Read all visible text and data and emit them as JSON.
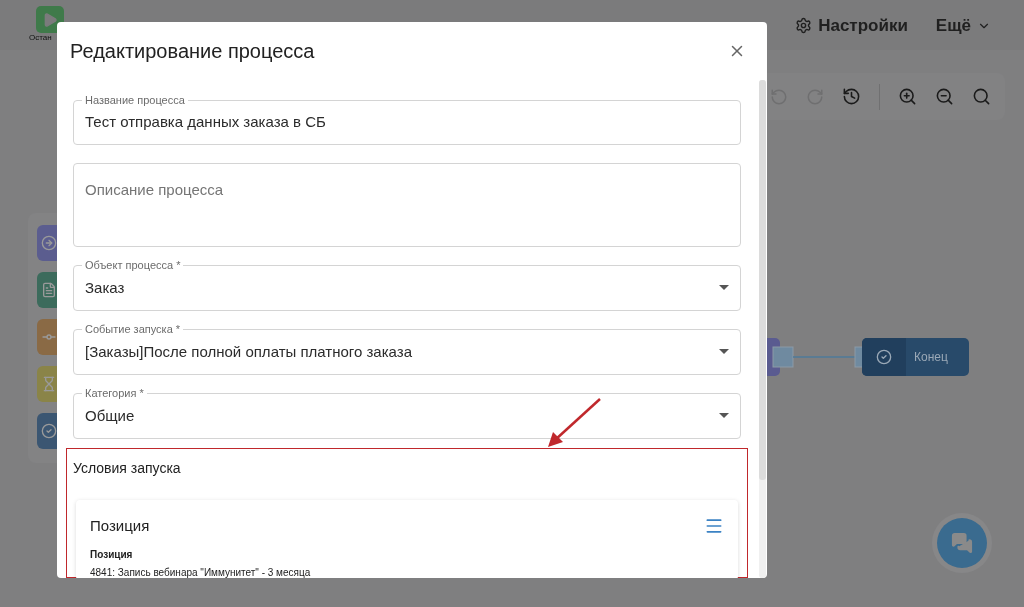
{
  "header": {
    "run_label": "Остан",
    "settings": "Настройки",
    "more": "Ещё"
  },
  "canvas": {
    "end_node": "Конец"
  },
  "modal": {
    "title": "Редактирование процесса",
    "fields": [
      {
        "kind": "text",
        "label": "Название процесса",
        "value": "Тест отправка данных заказа в СБ"
      },
      {
        "kind": "textarea",
        "placeholder": "Описание процесса"
      },
      {
        "kind": "select",
        "label": "Объект процесса *",
        "value": "Заказ"
      },
      {
        "kind": "select",
        "label": "Событие запуска *",
        "value": "[Заказы]После полной оплаты платного заказа"
      },
      {
        "kind": "select",
        "label": "Категория *",
        "value": "Общие"
      }
    ],
    "conditions": {
      "title": "Условия запуска",
      "card": {
        "title": "Позиция",
        "field_label": "Позиция",
        "field_value": "4841: Запись вебинара \"Иммунитет\" - 3 месяца"
      }
    }
  }
}
